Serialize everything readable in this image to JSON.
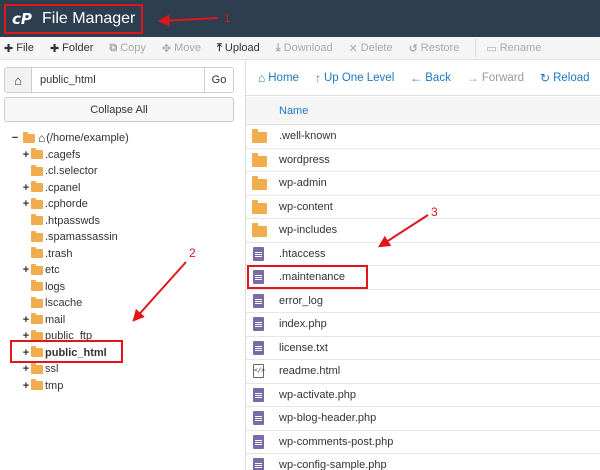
{
  "header": {
    "logo_text": "cP",
    "title": "File Manager"
  },
  "toolbar": {
    "items": [
      {
        "icon": "plus-icon",
        "label": "File",
        "disabled": false
      },
      {
        "icon": "plus-icon",
        "label": "Folder",
        "disabled": false
      },
      {
        "icon": "copy-icon",
        "label": "Copy",
        "disabled": true
      },
      {
        "icon": "move-icon",
        "label": "Move",
        "disabled": true
      },
      {
        "icon": "upload-icon",
        "label": "Upload",
        "disabled": false
      },
      {
        "icon": "download-icon",
        "label": "Download",
        "disabled": true
      },
      {
        "icon": "delete-icon",
        "label": "Delete",
        "disabled": true
      },
      {
        "icon": "restore-icon",
        "label": "Restore",
        "disabled": true
      },
      {
        "icon": "rename-icon",
        "label": "Rename",
        "disabled": true
      }
    ]
  },
  "left": {
    "path_value": "public_html",
    "go_label": "Go",
    "collapse_label": "Collapse All",
    "tree": [
      {
        "label": "(/home/example)",
        "toggle": "−",
        "level": 0,
        "root": true
      },
      {
        "label": ".cagefs",
        "toggle": "+",
        "level": 1
      },
      {
        "label": ".cl.selector",
        "toggle": "",
        "level": 1
      },
      {
        "label": ".cpanel",
        "toggle": "+",
        "level": 1
      },
      {
        "label": ".cphorde",
        "toggle": "+",
        "level": 1
      },
      {
        "label": ".htpasswds",
        "toggle": "",
        "level": 1
      },
      {
        "label": ".spamassassin",
        "toggle": "",
        "level": 1
      },
      {
        "label": ".trash",
        "toggle": "",
        "level": 1
      },
      {
        "label": "etc",
        "toggle": "+",
        "level": 1
      },
      {
        "label": "logs",
        "toggle": "",
        "level": 1
      },
      {
        "label": "lscache",
        "toggle": "",
        "level": 1
      },
      {
        "label": "mail",
        "toggle": "+",
        "level": 1
      },
      {
        "label": "public_ftp",
        "toggle": "+",
        "level": 1
      },
      {
        "label": "public_html",
        "toggle": "+",
        "level": 1,
        "bold": true
      },
      {
        "label": "ssl",
        "toggle": "+",
        "level": 1
      },
      {
        "label": "tmp",
        "toggle": "+",
        "level": 1
      }
    ]
  },
  "right": {
    "nav": [
      {
        "icon": "home-icon",
        "label": "Home",
        "disabled": false
      },
      {
        "icon": "up-arrow-icon",
        "label": "Up One Level",
        "disabled": false
      },
      {
        "icon": "back-arrow-icon",
        "label": "Back",
        "disabled": false
      },
      {
        "icon": "forward-arrow-icon",
        "label": "Forward",
        "disabled": true
      },
      {
        "icon": "reload-icon",
        "label": "Reload",
        "disabled": false
      }
    ],
    "column_name": "Name",
    "files": [
      {
        "name": ".well-known",
        "type": "folder"
      },
      {
        "name": "wordpress",
        "type": "folder"
      },
      {
        "name": "wp-admin",
        "type": "folder"
      },
      {
        "name": "wp-content",
        "type": "folder"
      },
      {
        "name": "wp-includes",
        "type": "folder"
      },
      {
        "name": ".htaccess",
        "type": "doc"
      },
      {
        "name": ".maintenance",
        "type": "doc"
      },
      {
        "name": "error_log",
        "type": "doc"
      },
      {
        "name": "index.php",
        "type": "doc"
      },
      {
        "name": "license.txt",
        "type": "doc"
      },
      {
        "name": "readme.html",
        "type": "code"
      },
      {
        "name": "wp-activate.php",
        "type": "doc"
      },
      {
        "name": "wp-blog-header.php",
        "type": "doc"
      },
      {
        "name": "wp-comments-post.php",
        "type": "doc"
      },
      {
        "name": "wp-config-sample.php",
        "type": "doc"
      }
    ]
  },
  "annotations": {
    "n1": "1",
    "n2": "2",
    "n3": "3",
    "color": "#e0161b"
  }
}
